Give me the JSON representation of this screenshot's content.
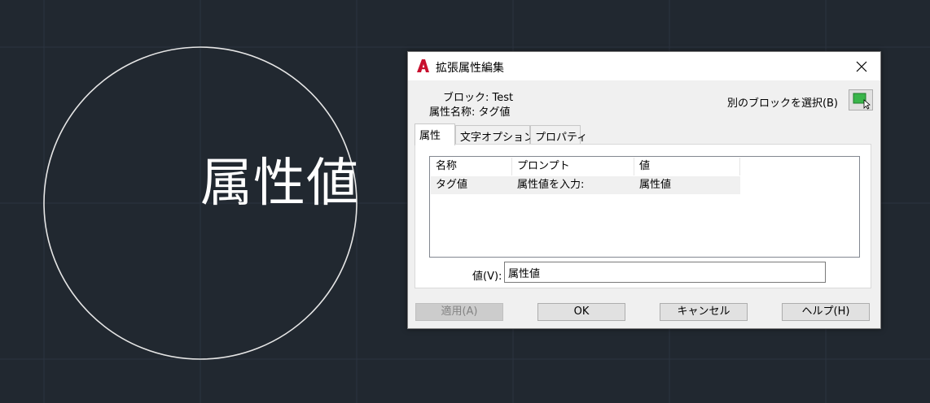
{
  "canvas": {
    "text": "属性値",
    "background_color": "#212830",
    "grid_color": "#2c3440",
    "circle_color": "#e6e6e6"
  },
  "dialog": {
    "title": "拡張属性編集",
    "app_icon": "autocad-a-logo-icon",
    "close_icon": "close-icon",
    "block_label": "ブロック: Test",
    "tag_label": "属性名称: タグ値",
    "select_other_label": "別のブロックを選択(B)",
    "pick_icon": "select-block-pick-icon",
    "tabs": [
      {
        "label": "属性",
        "active": true
      },
      {
        "label": "文字オプション",
        "active": false
      },
      {
        "label": "プロパティ",
        "active": false
      }
    ],
    "table": {
      "headers": [
        "名称",
        "プロンプト",
        "値"
      ],
      "rows": [
        [
          "タグ値",
          "属性値を入力:",
          "属性値"
        ]
      ]
    },
    "value_label": "値(V):",
    "value": "属性値",
    "buttons": {
      "apply": "適用(A)",
      "ok": "OK",
      "cancel": "キャンセル",
      "help": "ヘルプ(H)"
    },
    "accent_color": "#c8102e"
  }
}
